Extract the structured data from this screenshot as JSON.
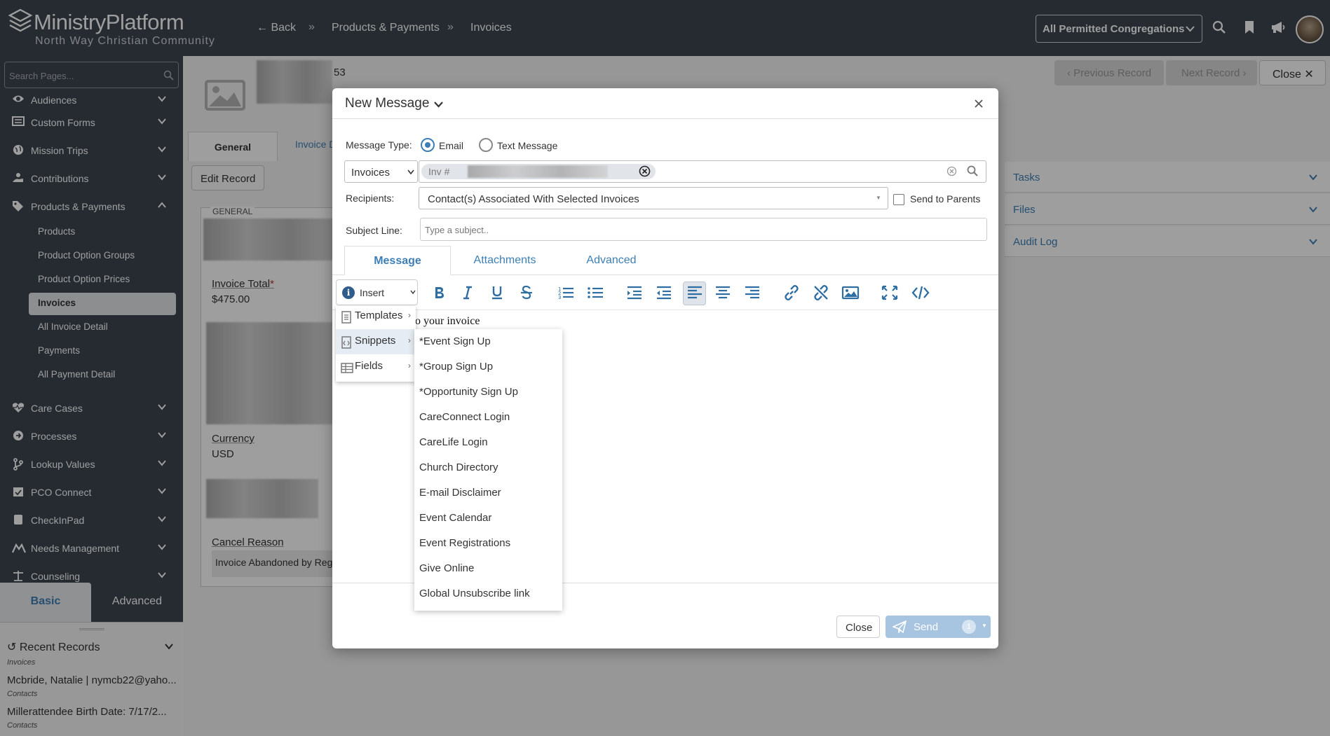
{
  "app": {
    "name": "MinistryPlatform",
    "org": "North Way Christian Community"
  },
  "breadcrumb": {
    "back": "Back",
    "items": [
      "Products & Payments",
      "Invoices"
    ]
  },
  "header": {
    "congregation": "All Permitted Congregations"
  },
  "sidebar": {
    "search_placeholder": "Search Pages...",
    "items": [
      {
        "label": "Audiences",
        "icon": "eye-icon"
      },
      {
        "label": "Custom Forms",
        "icon": "form-icon"
      },
      {
        "label": "Mission Trips",
        "icon": "globe-icon"
      },
      {
        "label": "Contributions",
        "icon": "hand-icon"
      },
      {
        "label": "Products & Payments",
        "icon": "tags-icon"
      }
    ],
    "sub_items": [
      "Products",
      "Product Option Groups",
      "Product Option Prices",
      "Invoices",
      "All Invoice Detail",
      "Payments",
      "All Payment Detail"
    ],
    "items_after": [
      {
        "label": "Care Cases",
        "icon": "heartbeat-icon"
      },
      {
        "label": "Processes",
        "icon": "arrow-circle-icon"
      },
      {
        "label": "Lookup Values",
        "icon": "branch-icon"
      },
      {
        "label": "PCO Connect",
        "icon": "calendar-check-icon"
      },
      {
        "label": "CheckInPad",
        "icon": "tablet-icon"
      },
      {
        "label": "Needs Management",
        "icon": "hands-icon"
      },
      {
        "label": "Counseling",
        "icon": "balance-icon"
      }
    ],
    "tabs": {
      "basic": "Basic",
      "advanced": "Advanced"
    },
    "recent": {
      "title": "Recent Records",
      "records": [
        {
          "category": "Invoices",
          "text": "Mcbride, Natalie | nymcb22@yaho..."
        },
        {
          "category": "Contacts",
          "text": "Millerattendee Birth Date: 7/17/2..."
        },
        {
          "category": "Contacts",
          "text": ""
        }
      ]
    }
  },
  "record": {
    "id_suffix": "53",
    "tabs": {
      "general": "General",
      "invoice_detail": "Invoice D"
    },
    "edit_label": "Edit Record",
    "section": "GENERAL",
    "invoice_total_label": "Invoice Total",
    "required_mark": "*",
    "invoice_total": "$475.00",
    "currency_label": "Currency",
    "currency": "USD",
    "cancel_reason_label": "Cancel Reason",
    "cancel_reason": "Invoice Abandoned by Reg",
    "nav": {
      "previous": "Previous Record",
      "next": "Next Record",
      "close": "Close"
    },
    "right_panels": [
      "Tasks",
      "Files",
      "Audit Log"
    ]
  },
  "modal": {
    "title": "New Message",
    "message_type_label": "Message Type:",
    "type_email": "Email",
    "type_text": "Text Message",
    "selection_source": "Invoices",
    "selection_chip": "Inv #",
    "recipients_label": "Recipients:",
    "recipients_value": "Contact(s) Associated With Selected Invoices",
    "send_to_parents": "Send to Parents",
    "subject_label": "Subject Line:",
    "subject_placeholder": "Type a subject..",
    "tabs": [
      "Message",
      "Attachments",
      "Advanced"
    ],
    "insert_label": "Insert",
    "editor_text": "o your invoice",
    "close_label": "Close",
    "send_label": "Send",
    "send_count": "1",
    "insert_menu": [
      {
        "label": "Templates",
        "icon": "template-icon"
      },
      {
        "label": "Snippets",
        "icon": "snippet-icon"
      },
      {
        "label": "Fields",
        "icon": "table-icon"
      }
    ],
    "snippets": [
      "*Event Sign Up",
      "*Group Sign Up",
      "*Opportunity Sign Up",
      "CareConnect Login",
      "CareLife Login",
      "Church Directory",
      "E-mail Disclaimer",
      "Event Calendar",
      "Event Registrations",
      "Give Online",
      "Global Unsubscribe link"
    ]
  },
  "colors": {
    "topbar": "#3e4651",
    "accent": "#3d7fb5",
    "toolbar_icon": "#2f6ea3"
  }
}
